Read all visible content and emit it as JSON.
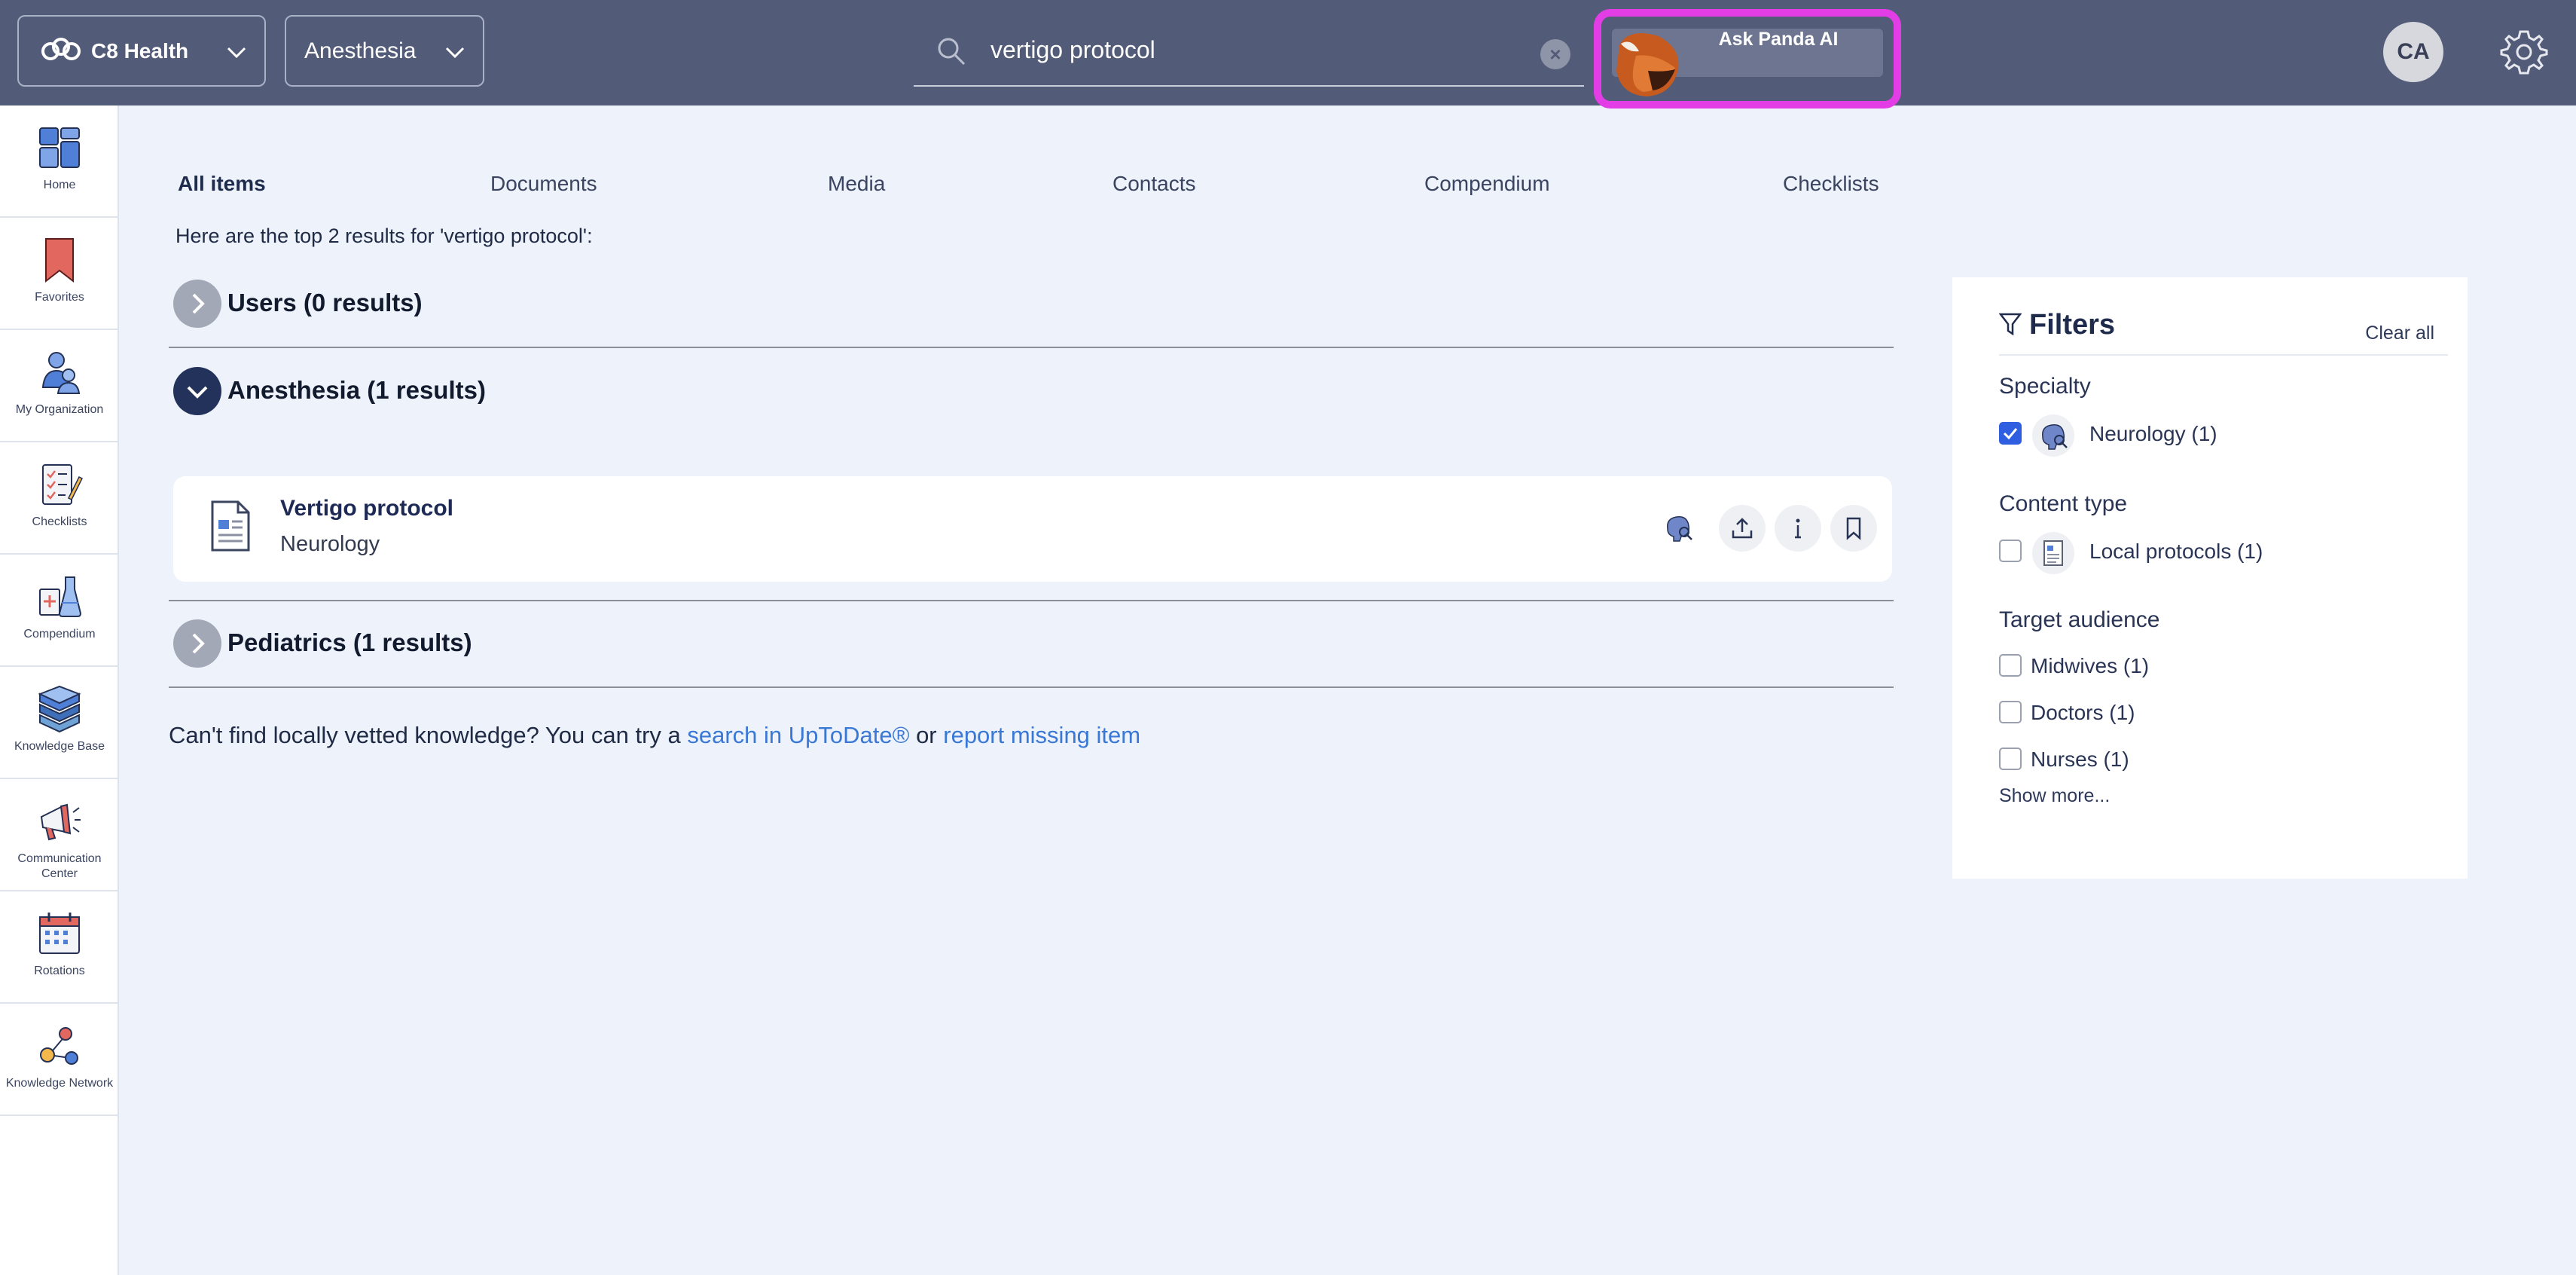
{
  "header": {
    "org_name": "C8 Health",
    "department": "Anesthesia",
    "search": {
      "value": "vertigo protocol"
    },
    "ask_panda_label": "Ask Panda AI",
    "user_initials": "CA"
  },
  "sidebar": {
    "items": [
      {
        "label": "Home",
        "icon": "home-icon"
      },
      {
        "label": "Favorites",
        "icon": "bookmark-icon"
      },
      {
        "label": "My Organization",
        "icon": "organization-icon"
      },
      {
        "label": "Checklists",
        "icon": "checklist-icon"
      },
      {
        "label": "Compendium",
        "icon": "compendium-icon"
      },
      {
        "label": "Knowledge Base",
        "icon": "books-icon"
      },
      {
        "label": "Communication Center",
        "icon": "megaphone-icon"
      },
      {
        "label": "Rotations",
        "icon": "calendar-icon"
      },
      {
        "label": "Knowledge Network",
        "icon": "network-icon"
      }
    ]
  },
  "tabs": [
    {
      "label": "All items",
      "active": true
    },
    {
      "label": "Documents"
    },
    {
      "label": "Media"
    },
    {
      "label": "Contacts"
    },
    {
      "label": "Compendium"
    },
    {
      "label": "Checklists"
    }
  ],
  "results": {
    "intro": "Here are the top 2 results for 'vertigo protocol':",
    "groups": [
      {
        "title": "Users (0 results)",
        "expanded": false
      },
      {
        "title": "Anesthesia (1 results)",
        "expanded": true
      },
      {
        "title": "Pediatrics (1 results)",
        "expanded": false
      }
    ],
    "item": {
      "title": "Vertigo protocol",
      "subtitle": "Neurology"
    }
  },
  "footer": {
    "prefix": "Can't find locally vetted knowledge? You can try a ",
    "link1": "search in UpToDate®",
    "middle": " or ",
    "link2": "report missing item"
  },
  "filters": {
    "title": "Filters",
    "clear_all": "Clear all",
    "specialty": {
      "label": "Specialty",
      "options": [
        {
          "label": "Neurology (1)",
          "checked": true
        }
      ]
    },
    "content_type": {
      "label": "Content type",
      "options": [
        {
          "label": "Local protocols (1)",
          "checked": false
        }
      ]
    },
    "target_audience": {
      "label": "Target audience",
      "options": [
        {
          "label": "Midwives (1)",
          "checked": false
        },
        {
          "label": "Doctors (1)",
          "checked": false
        },
        {
          "label": "Nurses (1)",
          "checked": false
        }
      ]
    },
    "show_more": "Show more..."
  },
  "colors": {
    "header_bg": "#525b78",
    "accent_highlight": "#e33de6",
    "link": "#3a78d6",
    "checkbox_checked": "#2f5fe0"
  }
}
